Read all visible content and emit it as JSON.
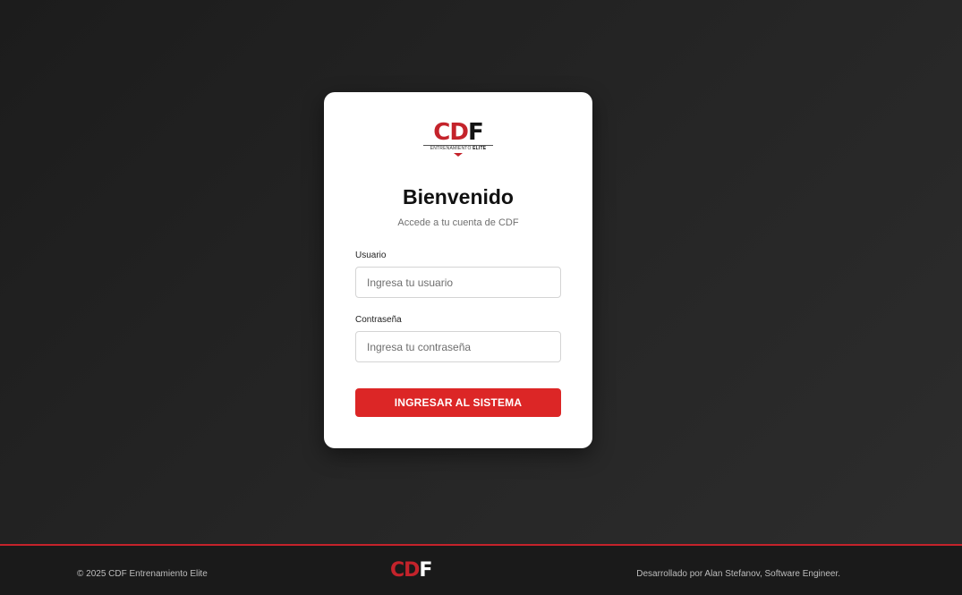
{
  "login": {
    "logo": {
      "c": "C",
      "d": "D",
      "f": "F",
      "tagline_normal": "ENTRENAMIENTO",
      "tagline_bold": "ELITE"
    },
    "title": "Bienvenido",
    "subtitle": "Accede a tu cuenta de CDF",
    "username": {
      "label": "Usuario",
      "placeholder": "Ingresa tu usuario",
      "value": ""
    },
    "password": {
      "label": "Contraseña",
      "placeholder": "Ingresa tu contraseña",
      "value": ""
    },
    "submit_label": "INGRESAR AL SISTEMA"
  },
  "footer": {
    "copyright": "© 2025 CDF Entrenamiento Elite",
    "logo": {
      "c": "C",
      "d": "D",
      "f": "F"
    },
    "credit": "Desarrollado por Alan Stefanov, Software Engineer."
  },
  "colors": {
    "accent": "#dc2626",
    "brand_red": "#c4232b",
    "background": "#222222",
    "card": "#ffffff",
    "footer": "#1a1a1a"
  }
}
